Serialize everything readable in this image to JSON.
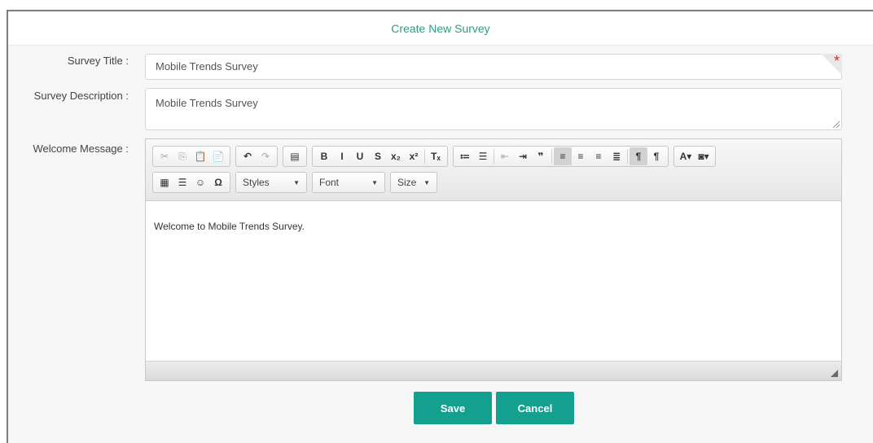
{
  "header": {
    "title": "Create New Survey"
  },
  "form": {
    "title_label": "Survey Title :",
    "title_value": "Mobile Trends Survey",
    "required_mark": "*",
    "description_label": "Survey Description :",
    "description_value": "Mobile Trends Survey",
    "welcome_label": "Welcome Message :",
    "welcome_value": "Welcome to Mobile Trends Survey."
  },
  "toolbar": {
    "row1": [
      {
        "group": [
          {
            "name": "cut-icon",
            "glyph": "✂",
            "state": "dim"
          },
          {
            "name": "copy-icon",
            "glyph": "⎘",
            "state": "dim"
          },
          {
            "name": "paste-icon",
            "glyph": "📋",
            "state": ""
          },
          {
            "name": "paste-text-icon",
            "glyph": "📄",
            "state": ""
          }
        ]
      },
      {
        "group": [
          {
            "name": "undo-icon",
            "glyph": "↶",
            "state": ""
          },
          {
            "name": "redo-icon",
            "glyph": "↷",
            "state": "dim"
          }
        ]
      },
      {
        "group": [
          {
            "name": "template-icon",
            "glyph": "▤",
            "state": ""
          }
        ]
      },
      {
        "group": [
          {
            "name": "bold-icon",
            "glyph": "B",
            "state": ""
          },
          {
            "name": "italic-icon",
            "glyph": "I",
            "state": ""
          },
          {
            "name": "underline-icon",
            "glyph": "U",
            "state": ""
          },
          {
            "name": "strike-icon",
            "glyph": "S",
            "state": ""
          },
          {
            "name": "subscript-icon",
            "glyph": "x₂",
            "state": ""
          },
          {
            "name": "superscript-icon",
            "glyph": "x²",
            "state": ""
          },
          {
            "name": "sep",
            "glyph": "",
            "state": ""
          },
          {
            "name": "remove-format-icon",
            "glyph": "Tₓ",
            "state": ""
          }
        ]
      },
      {
        "group": [
          {
            "name": "numbered-list-icon",
            "glyph": "≔",
            "state": ""
          },
          {
            "name": "bulleted-list-icon",
            "glyph": "☰",
            "state": ""
          },
          {
            "name": "sep",
            "glyph": "",
            "state": ""
          },
          {
            "name": "outdent-icon",
            "glyph": "⇤",
            "state": "dim"
          },
          {
            "name": "indent-icon",
            "glyph": "⇥",
            "state": ""
          },
          {
            "name": "blockquote-icon",
            "glyph": "❞",
            "state": ""
          },
          {
            "name": "sep",
            "glyph": "",
            "state": ""
          },
          {
            "name": "align-left-icon",
            "glyph": "≡",
            "state": "on"
          },
          {
            "name": "align-center-icon",
            "glyph": "≡",
            "state": ""
          },
          {
            "name": "align-right-icon",
            "glyph": "≡",
            "state": ""
          },
          {
            "name": "align-justify-icon",
            "glyph": "≣",
            "state": ""
          },
          {
            "name": "sep",
            "glyph": "",
            "state": ""
          },
          {
            "name": "ltr-icon",
            "glyph": "¶",
            "state": "on"
          },
          {
            "name": "rtl-icon",
            "glyph": "¶",
            "state": ""
          }
        ]
      },
      {
        "group": [
          {
            "name": "text-color-icon",
            "glyph": "A▾",
            "state": ""
          },
          {
            "name": "bg-color-icon",
            "glyph": "◙▾",
            "state": ""
          }
        ]
      }
    ],
    "row2_icons": [
      {
        "name": "table-icon",
        "glyph": "▦"
      },
      {
        "name": "horizontal-rule-icon",
        "glyph": "☰"
      },
      {
        "name": "smiley-icon",
        "glyph": "☺"
      },
      {
        "name": "special-char-icon",
        "glyph": "Ω"
      }
    ],
    "combos": [
      {
        "name": "styles-combo",
        "label": "Styles",
        "width": 88
      },
      {
        "name": "font-combo",
        "label": "Font",
        "width": 90
      },
      {
        "name": "size-combo",
        "label": "Size",
        "width": 58
      }
    ]
  },
  "buttons": {
    "save": "Save",
    "cancel": "Cancel"
  },
  "colors": {
    "accent": "#14a08e",
    "title": "#2a9d82",
    "required": "#d43030"
  }
}
